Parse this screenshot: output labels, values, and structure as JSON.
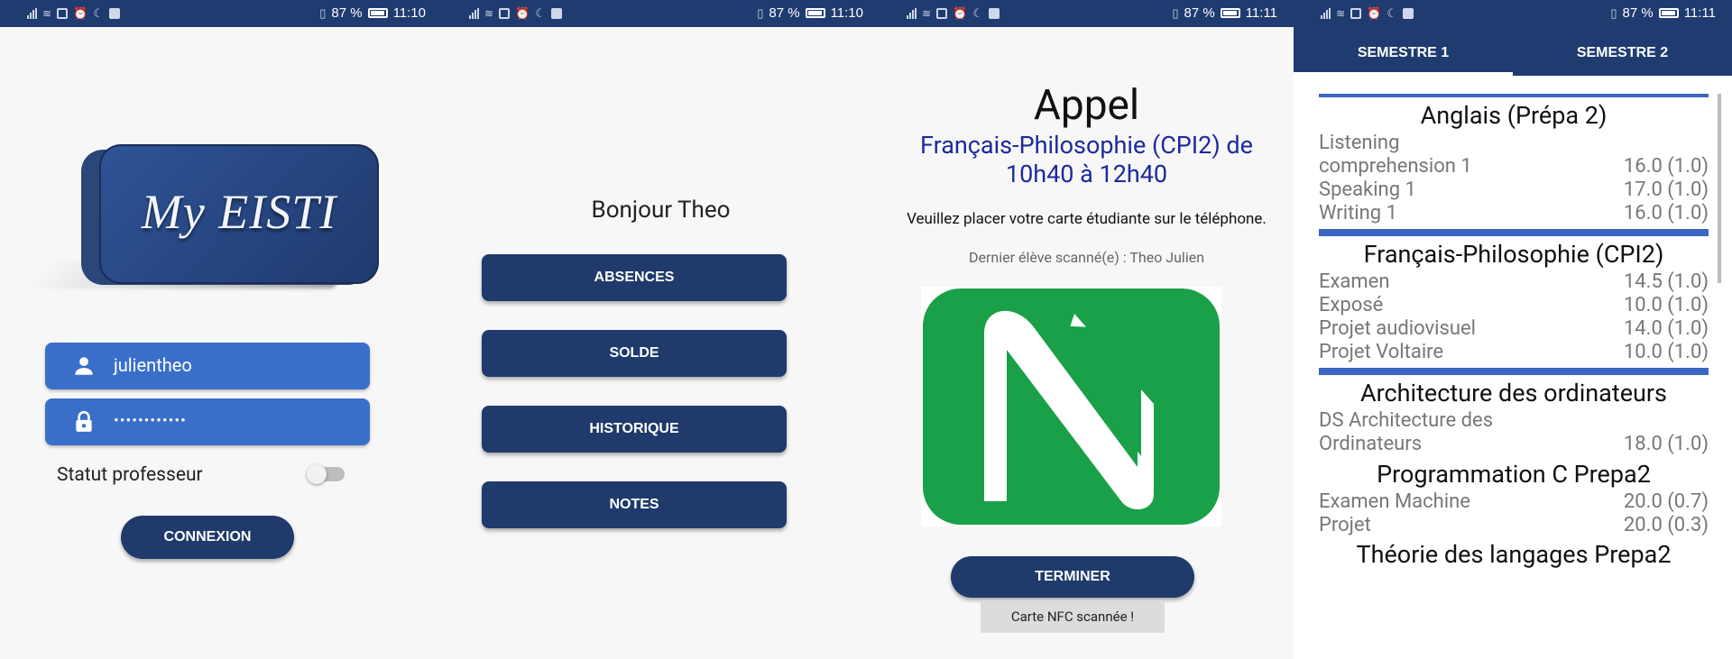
{
  "status_bars": [
    {
      "battery": "87 %",
      "time": "11:10"
    },
    {
      "battery": "87 %",
      "time": "11:10"
    },
    {
      "battery": "87 %",
      "time": "11:11"
    },
    {
      "battery": "87 %",
      "time": "11:11"
    }
  ],
  "login": {
    "logo_text": "My EISTI",
    "username": "julientheo",
    "password_mask": "••••••••••••",
    "statut_label": "Statut professeur",
    "statut_on": false,
    "connect_label": "CONNEXION"
  },
  "menu": {
    "greeting": "Bonjour Theo",
    "buttons": [
      "ABSENCES",
      "SOLDE",
      "HISTORIQUE",
      "NOTES"
    ]
  },
  "appel": {
    "title": "Appel",
    "course_line1": "Français-Philosophie (CPI2) de",
    "course_line2": "10h40 à 12h40",
    "instruction": "Veuillez placer votre carte étudiante sur le téléphone.",
    "last_scanned": "Dernier élève scanné(e) : Theo Julien",
    "finish_label": "TERMINER",
    "toast": "Carte NFC scannée !"
  },
  "notes": {
    "tabs": [
      "SEMESTRE 1",
      "SEMESTRE 2"
    ],
    "active_tab": 0,
    "subjects": [
      {
        "name": "Anglais (Prépa 2)",
        "grades": [
          {
            "label": "Listening comprehension 1",
            "value": "16.0 (1.0)"
          },
          {
            "label": "Speaking 1",
            "value": "17.0 (1.0)"
          },
          {
            "label": "Writing 1",
            "value": "16.0 (1.0)"
          }
        ]
      },
      {
        "name": "Français-Philosophie (CPI2)",
        "grades": [
          {
            "label": "Examen",
            "value": "14.5 (1.0)"
          },
          {
            "label": "Exposé",
            "value": "10.0 (1.0)"
          },
          {
            "label": "Projet audiovisuel",
            "value": "14.0 (1.0)"
          },
          {
            "label": "Projet Voltaire",
            "value": "10.0 (1.0)"
          }
        ]
      },
      {
        "name": "Architecture des ordinateurs",
        "grades": [
          {
            "label": "DS Architecture des Ordinateurs",
            "value": "18.0 (1.0)"
          }
        ]
      },
      {
        "name": "Programmation C Prepa2",
        "grades": [
          {
            "label": "Examen Machine",
            "value": "20.0 (0.7)"
          },
          {
            "label": "Projet",
            "value": "20.0 (0.3)"
          }
        ]
      },
      {
        "name": "Théorie des langages Prepa2",
        "grades": []
      }
    ]
  },
  "colors": {
    "primary": "#1f3b70",
    "field": "#3a6fc9",
    "accent_text": "#1d2a9c",
    "nfc_green": "#1aa049"
  }
}
